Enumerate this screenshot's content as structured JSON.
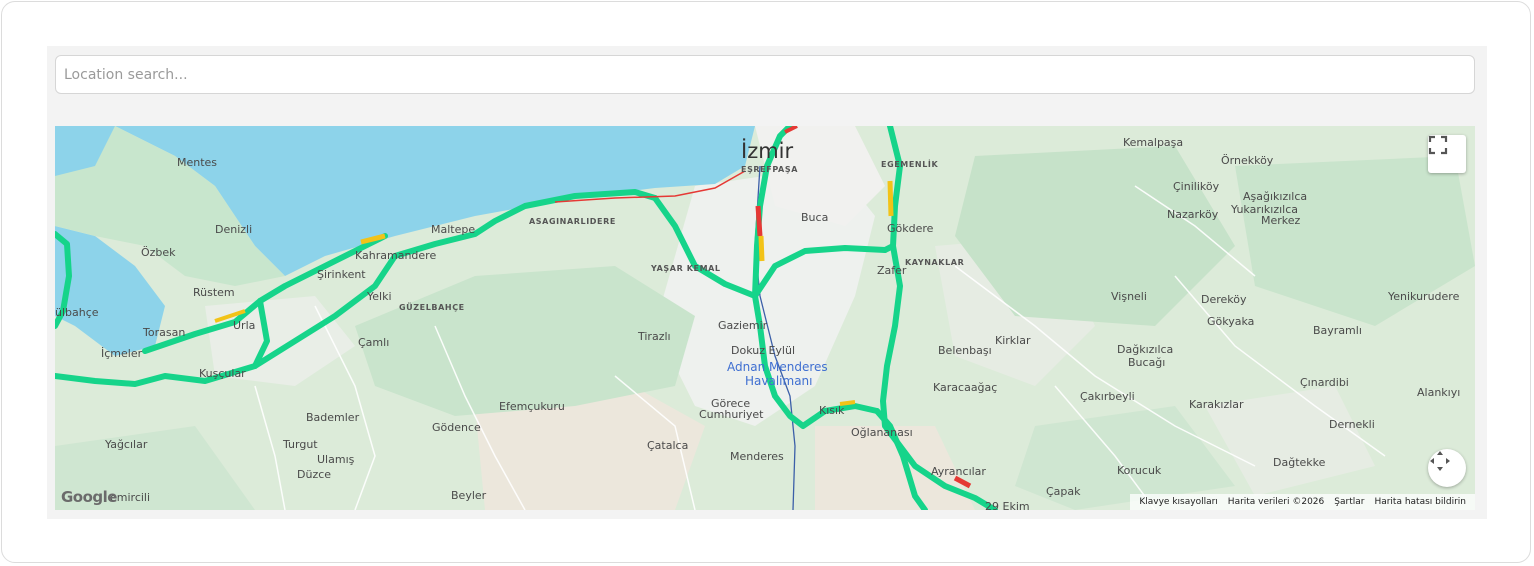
{
  "search": {
    "placeholder": "Location search..."
  },
  "map": {
    "city_label": "İzmir",
    "airport_label_line1": "Adnan Menderes",
    "airport_label_line2": "Havalimanı",
    "place_labels": [
      "Mentes",
      "Denizli",
      "Özbek",
      "Rüstem",
      "Torasan",
      "Urla",
      "İçmeler",
      "Kuşçular",
      "Şirinkent",
      "Kahramandere",
      "Maltepe",
      "Yelki",
      "Çamlı",
      "Bademler",
      "Turgut",
      "Ulamış",
      "Düzce",
      "Yağcılar",
      "Gödence",
      "Efemçukuru",
      "Beyler",
      "Tirazlı",
      "Gaziemir",
      "Dokuz Eylül",
      "Görece",
      "Cumhuriyet",
      "Çatalca",
      "Menderes",
      "Buca",
      "Gökdere",
      "Zafer",
      "Kısık",
      "Oğlananası",
      "Ayrancılar",
      "29 Ekim",
      "Belenbaşı",
      "Kirklar",
      "Karacaağaç",
      "Çakırbeyli",
      "Çapak",
      "Korucuk",
      "Kemalpaşa",
      "Örnekköy",
      "Çiniliköy",
      "Aşağıkızılca",
      "Yukarıkızılca",
      "Merkez",
      "Nazarköy",
      "Vişneli",
      "Dereköy",
      "Gökyaka",
      "Yenikurudere",
      "Bayramlı",
      "Dağkızılca",
      "Bucağı",
      "Çınardibi",
      "Alankıyı",
      "Karakızlar",
      "Dernekli",
      "Dağtekke",
      "ülbahçe",
      "emircili"
    ],
    "district_labels": [
      "EŞREFPAŞA",
      "EGEMENLİK",
      "ASAGINARLIDERE",
      "YAŞAR KEMAL",
      "GÜZELBAHÇE",
      "KAYNAKLAR"
    ],
    "logo_text": "Google",
    "attribution": {
      "shortcuts": "Klavye kısayolları",
      "data": "Harita verileri ©2026",
      "terms": "Şartlar",
      "report": "Harita hatası bildirin"
    },
    "colors": {
      "water": "#8dd3ea",
      "land": "#dcebd9",
      "traffic_green": "#16d48a",
      "traffic_red": "#e53935",
      "traffic_yellow": "#f2c318"
    },
    "icons": {
      "fullscreen": "fullscreen-icon",
      "pan": "pan-arrows-icon"
    }
  }
}
